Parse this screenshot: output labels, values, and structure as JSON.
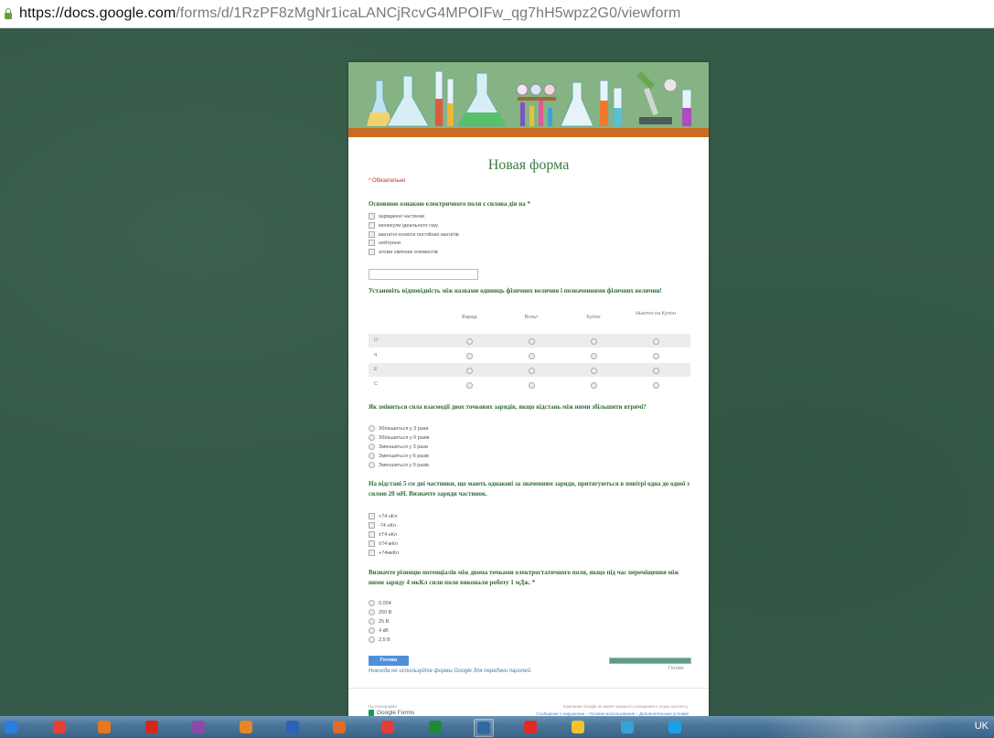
{
  "browser": {
    "url_host": "https://docs.google.com",
    "url_path": "/forms/d/1RzPF8zMgNr1icaLANCjRcvG4MPOIFw_qg7hH5wpz2G0/viewform"
  },
  "form": {
    "title": "Новая форма",
    "required_note": "* Обязательно",
    "q1": {
      "title": "Основною ознакою електричного поля є силова дія на *",
      "options": [
        "заряджені частинки",
        "молекули ідеального газу",
        "магнітні полюси постійних магнітів",
        "нейтрони",
        "атоми хімічних елементів"
      ]
    },
    "q2": {
      "title": "Установіть відповідність між назвами одиниць фізичних величин і позначеннями фізичних величин!",
      "columns": [
        "Фарад",
        "Вольт",
        "Кулон",
        "Ньютон на Кулон"
      ],
      "rows": [
        "U",
        "q",
        "E",
        "C"
      ]
    },
    "q3": {
      "title": "Як зміниться сила взаємодії двох точкових зарядів, якщо відстань між ними збільшити втричі?",
      "options": [
        "Збільшиться у 3 рази",
        "Збільшиться у 6 разів",
        "Зменшиться у 3 рази",
        "Зменшиться у 6 разів",
        "Зменшиться у 9 разів"
      ]
    },
    "q4": {
      "title": "На відстані 5 см дві частинки, що мають однакові за значенням заряди, притягуються в повітрі одна до одної з силою 20 мН. Визначте заряди частинок.",
      "options": [
        "+74 нКл",
        "-74 нКл",
        "±74 нКл",
        "±74 мКл",
        "+74мкКл"
      ]
    },
    "q5": {
      "title": "Визначте різницю потенціалів між двома точками електростатичного поля, якщо під час переміщення між ними заряду 4 мкКл сили поля виконали роботу 1 мДж. *",
      "options": [
        "0,004",
        "250 В",
        "25 В",
        "4 кВ",
        "2,5 В"
      ]
    },
    "submit_label": "Готово",
    "progress_label": "Готово",
    "never_submit": "Никогда не используйте формы Google для передачи паролей.",
    "platform_label": "На платформе",
    "platform_name": "Google Forms",
    "disclaimer": "Компания Google не имеет никакого отношения к этому контенту.",
    "footer_links": "Сообщение о нарушении – Условия использования – Дополнительные условия"
  },
  "taskbar": {
    "lang": "UK",
    "apps": [
      {
        "icon": "internet-explorer-icon",
        "color": "#2b7de0"
      },
      {
        "icon": "chrome-icon",
        "color": "#e34133"
      },
      {
        "icon": "firefox-icon",
        "color": "#e8781e"
      },
      {
        "icon": "acrobat-icon",
        "color": "#d6271d"
      },
      {
        "icon": "archive-icon",
        "color": "#8b4aa3"
      },
      {
        "icon": "media-player-icon",
        "color": "#e5862a"
      },
      {
        "icon": "save-icon",
        "color": "#2d62b5"
      },
      {
        "icon": "screenshot-icon",
        "color": "#e06b2a"
      },
      {
        "icon": "paint-icon",
        "color": "#e23d36"
      },
      {
        "icon": "excel-icon",
        "color": "#1f8a3b"
      },
      {
        "icon": "presentation-icon",
        "color": "#2d6aa3"
      },
      {
        "icon": "yandex-icon",
        "color": "#e02a27"
      },
      {
        "icon": "yandex-browser-icon",
        "color": "#f2c230"
      },
      {
        "icon": "network-icon",
        "color": "#3aa0d8"
      },
      {
        "icon": "skype-icon",
        "color": "#1ea0e8"
      }
    ]
  }
}
